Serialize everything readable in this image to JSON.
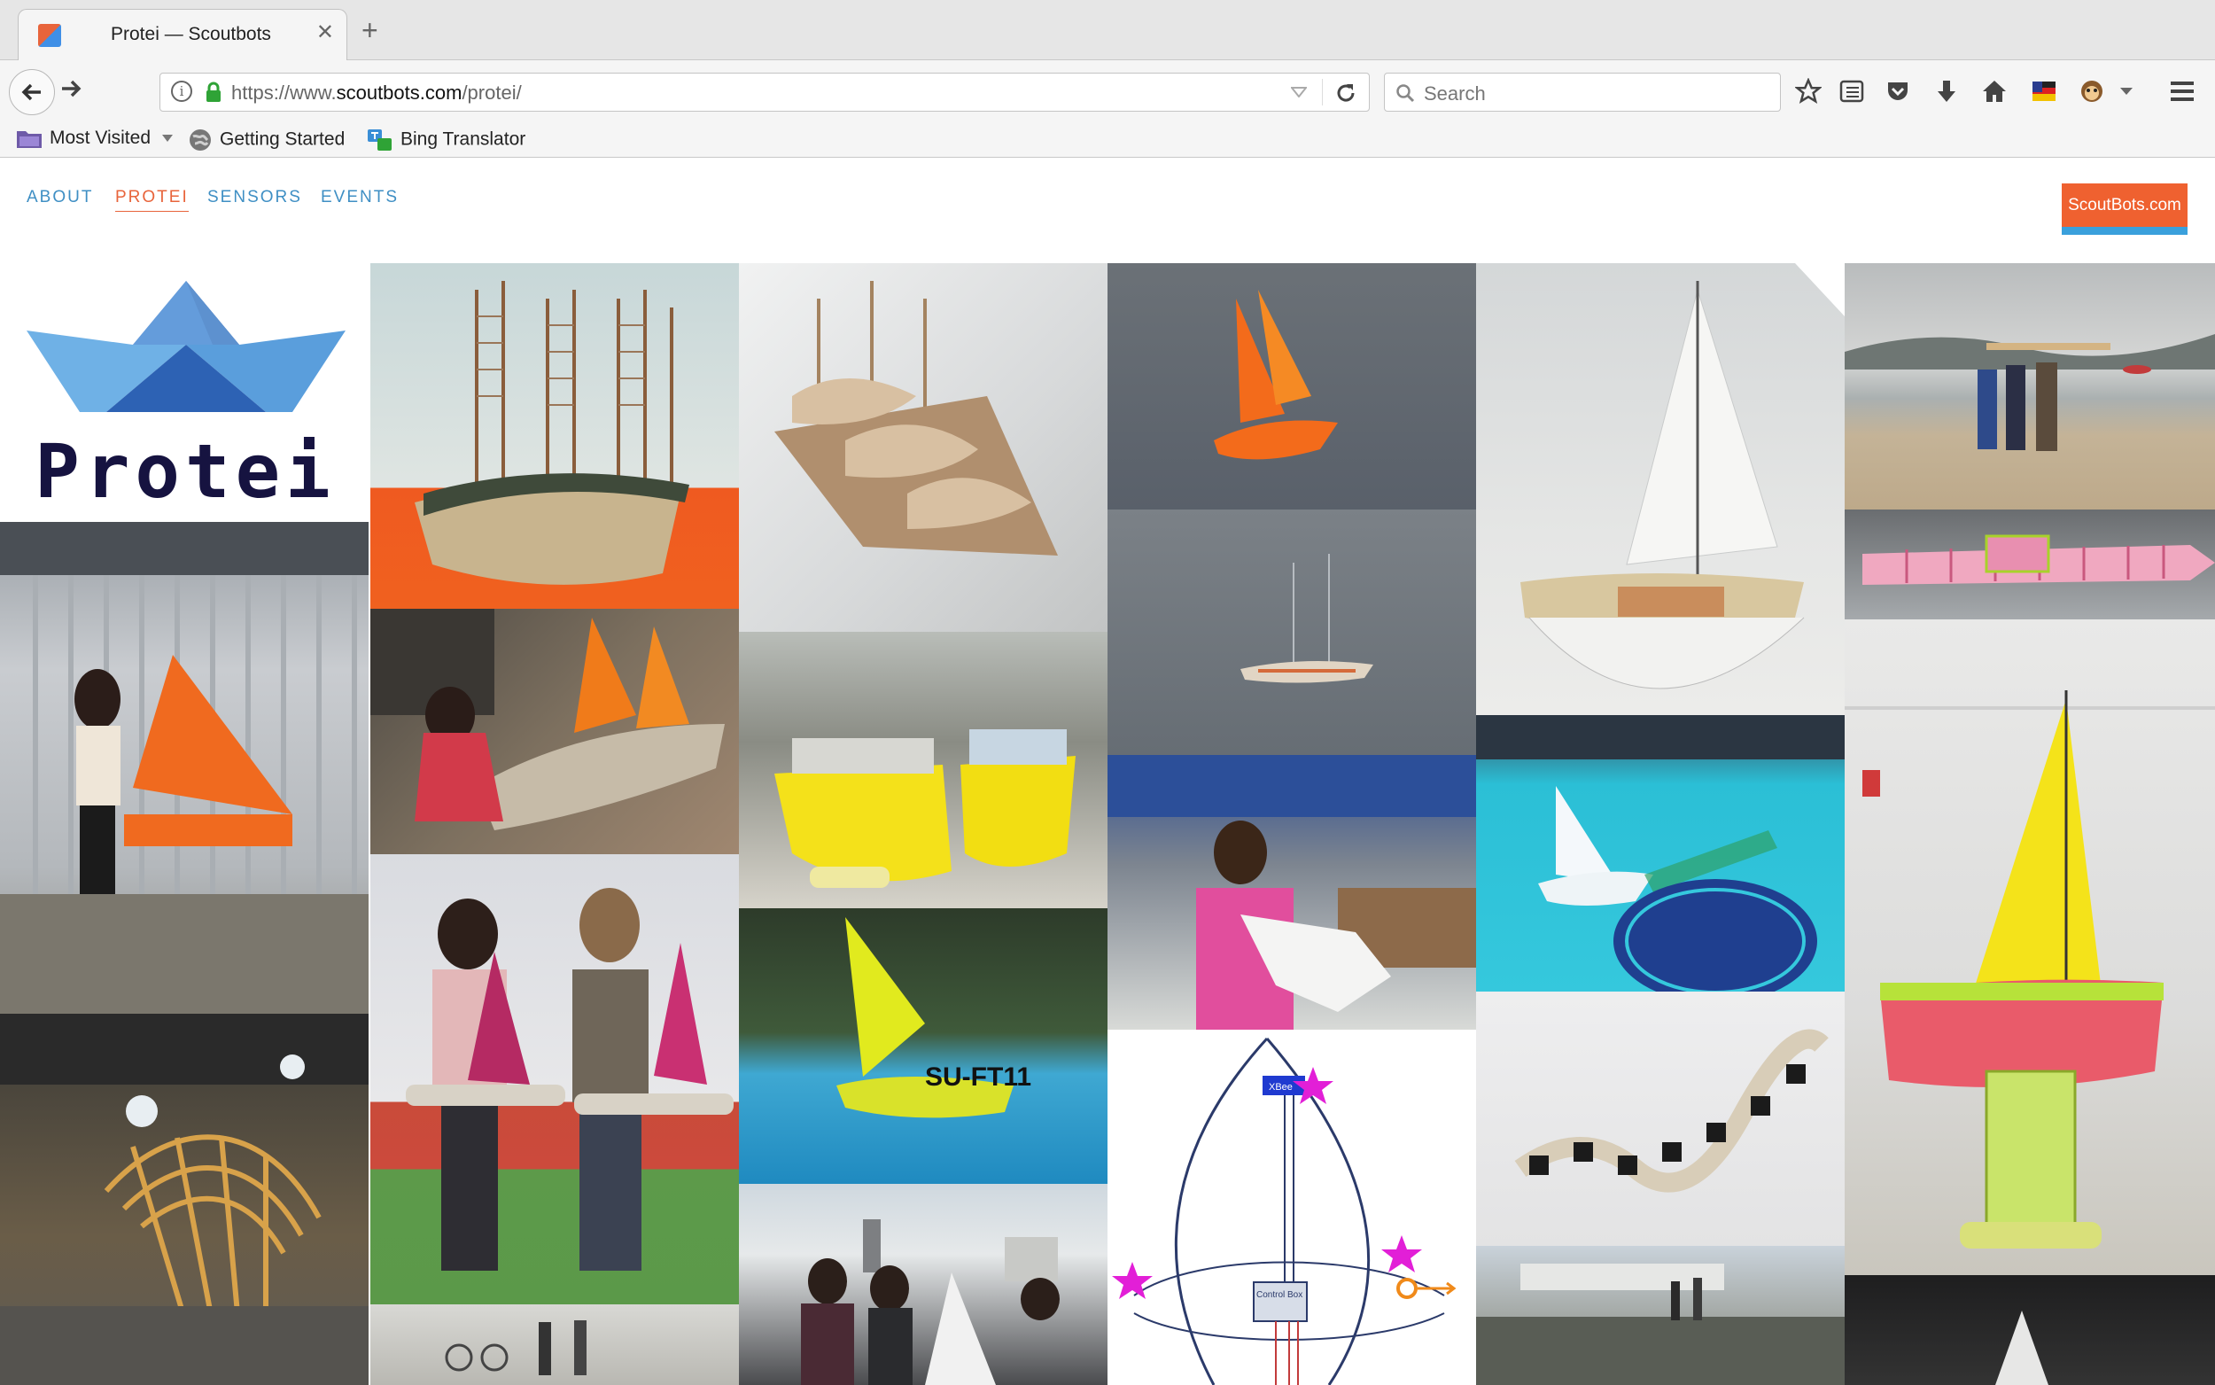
{
  "browser": {
    "tab_title": "Protei — Scoutbots",
    "close_glyph": "✕",
    "new_tab_glyph": "+",
    "url_prefix": "https://www.",
    "url_host": "scoutbots.com",
    "url_path": "/protei/",
    "search_placeholder": "Search"
  },
  "bookmarks": [
    {
      "label": "Most Visited",
      "icon": "folder-icon"
    },
    {
      "label": "Getting Started",
      "icon": "globe-icon"
    },
    {
      "label": "Bing Translator",
      "icon": "translator-icon"
    }
  ],
  "site_nav": {
    "items": [
      "ABOUT",
      "PROTEI",
      "SENSORS",
      "EVENTS"
    ],
    "active": "PROTEI"
  },
  "brand_button": "ScoutBots.com",
  "logo_text": "Protei",
  "diagram_labels": {
    "xbee": "XBee",
    "control_box": "Control Box"
  },
  "photo_overlay_text": "SU-FT11",
  "colors": {
    "accent_orange": "#ef6130",
    "accent_blue": "#3aa0dc",
    "nav_blue": "#3f8fc4",
    "logo_navy": "#161340"
  }
}
